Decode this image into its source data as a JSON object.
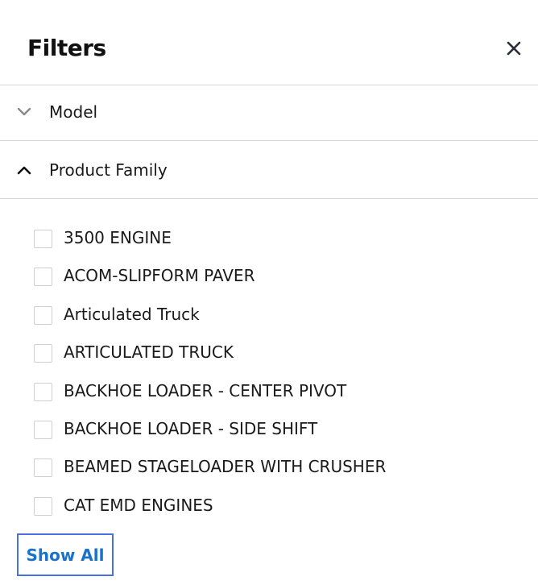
{
  "header": {
    "title": "Filters",
    "close_icon": "close-icon"
  },
  "sections": [
    {
      "label": "Model",
      "expanded": false,
      "icon": "chevron-down-icon"
    },
    {
      "label": "Product Family",
      "expanded": true,
      "icon": "chevron-up-icon"
    }
  ],
  "options": [
    {
      "label": "3500 ENGINE",
      "checked": false
    },
    {
      "label": "ACOM-SLIPFORM PAVER",
      "checked": false
    },
    {
      "label": "Articulated Truck",
      "checked": false
    },
    {
      "label": "ARTICULATED TRUCK",
      "checked": false
    },
    {
      "label": "BACKHOE LOADER - CENTER PIVOT",
      "checked": false
    },
    {
      "label": "BACKHOE LOADER - SIDE SHIFT",
      "checked": false
    },
    {
      "label": "BEAMED STAGELOADER WITH CRUSHER",
      "checked": false
    },
    {
      "label": "CAT EMD ENGINES",
      "checked": false
    }
  ],
  "show_all": {
    "label": "Show All"
  },
  "colors": {
    "accent": "#1a73c8",
    "focus_border": "#4a6fe0",
    "divider": "#d4d4d4",
    "checkbox_border": "#cfcfcf"
  }
}
